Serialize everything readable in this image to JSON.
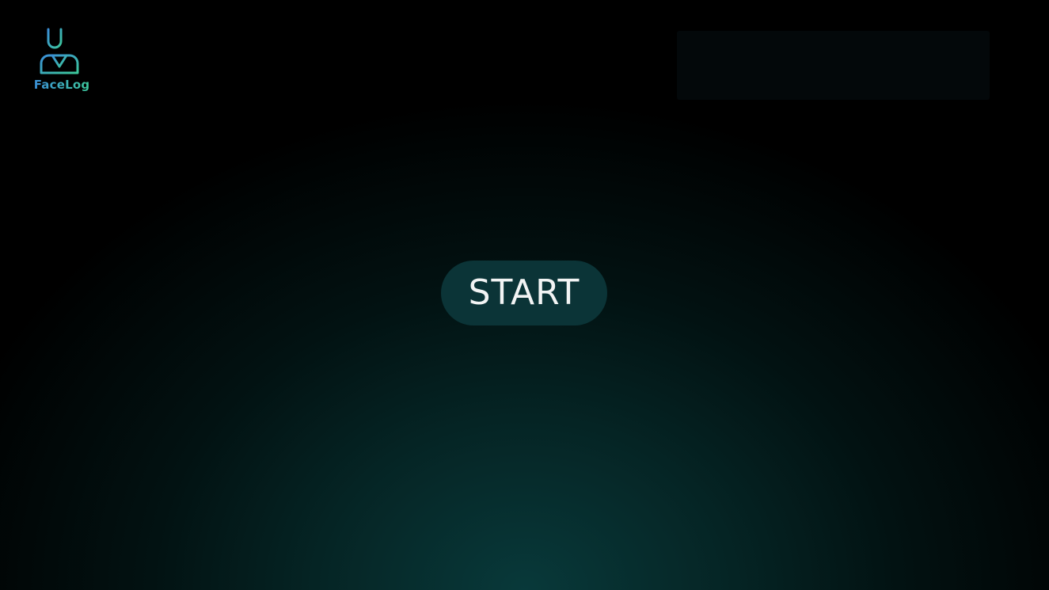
{
  "brand": {
    "name": "FaceLog",
    "logo_icon": "student-face-icon",
    "gradient": [
      "#3b8fd8",
      "#3cc79a"
    ]
  },
  "main": {
    "start_label": "START"
  },
  "colors": {
    "background": "#000000",
    "glow": "#08393a",
    "button_bg": "#0b3437",
    "button_text": "#f2f4f4",
    "panel_bg": "#03080a"
  }
}
